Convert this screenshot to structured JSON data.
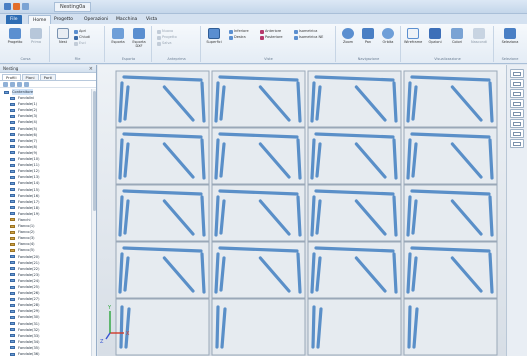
{
  "titlebar": {
    "doc_tab": "Nesting0a"
  },
  "tabs": [
    {
      "label": "File",
      "kind": "file"
    },
    {
      "label": "Home",
      "kind": "active"
    },
    {
      "label": "Progetto",
      "kind": "normal"
    },
    {
      "label": "Operazioni",
      "kind": "normal"
    },
    {
      "label": "Macchina",
      "kind": "normal"
    },
    {
      "label": "Vista",
      "kind": "normal"
    }
  ],
  "ribbon": {
    "groups": [
      {
        "name": "Corsa",
        "buttons": [
          "Progetto",
          "Prima"
        ]
      },
      {
        "name": "File",
        "buttons": [
          "Nest"
        ],
        "smalls": [
          "Apri",
          "Chiudi",
          "Esci"
        ]
      },
      {
        "name": "Esporta",
        "buttons": [
          "Esporta",
          "Esporta DXF"
        ]
      },
      {
        "name": "Anteprima",
        "smalls": [
          "Nuovo",
          "Progetto",
          "Salva"
        ]
      },
      {
        "name": "Viste",
        "buttons": [
          "Superfici"
        ],
        "smalls": [
          "Inferiore",
          "Destra",
          "Anteriore",
          "Posteriore",
          "Isometrica",
          "Isometrica NE"
        ]
      },
      {
        "name": "Navigazione",
        "buttons": [
          "Zoom",
          "Pan",
          "Orbita"
        ]
      },
      {
        "name": "Visualizzazione",
        "buttons": [
          "Wireframe",
          "Opzioni",
          "Colori",
          "Nascondi"
        ]
      },
      {
        "name": "Selezione",
        "buttons": [
          "Seleziona"
        ]
      }
    ]
  },
  "panel": {
    "title": "Nesting",
    "close": "×",
    "tabs": [
      "Profili",
      "Piani",
      "Parti"
    ],
    "tree": [
      {
        "label": "Contenitore",
        "indent": 0,
        "alt": false
      },
      {
        "label": "Fondalini",
        "indent": 1,
        "alt": false
      },
      {
        "label": "Fondale(1)",
        "indent": 1,
        "alt": false
      },
      {
        "label": "Fondale(2)",
        "indent": 1,
        "alt": false
      },
      {
        "label": "Fondale(3)",
        "indent": 1,
        "alt": false
      },
      {
        "label": "Fondale(4)",
        "indent": 1,
        "alt": false
      },
      {
        "label": "Fondale(5)",
        "indent": 1,
        "alt": false
      },
      {
        "label": "Fondale(6)",
        "indent": 1,
        "alt": false
      },
      {
        "label": "Fondale(7)",
        "indent": 1,
        "alt": false
      },
      {
        "label": "Fondale(8)",
        "indent": 1,
        "alt": false
      },
      {
        "label": "Fondale(9)",
        "indent": 1,
        "alt": false
      },
      {
        "label": "Fondale(10)",
        "indent": 1,
        "alt": false
      },
      {
        "label": "Fondale(11)",
        "indent": 1,
        "alt": false
      },
      {
        "label": "Fondale(12)",
        "indent": 1,
        "alt": false
      },
      {
        "label": "Fondale(13)",
        "indent": 1,
        "alt": false
      },
      {
        "label": "Fondale(14)",
        "indent": 1,
        "alt": false
      },
      {
        "label": "Fondale(15)",
        "indent": 1,
        "alt": false
      },
      {
        "label": "Fondale(16)",
        "indent": 1,
        "alt": false
      },
      {
        "label": "Fondale(17)",
        "indent": 1,
        "alt": false
      },
      {
        "label": "Fondale(18)",
        "indent": 1,
        "alt": false
      },
      {
        "label": "Fondale(19)",
        "indent": 1,
        "alt": false
      },
      {
        "label": "Fianchi",
        "indent": 1,
        "alt": true
      },
      {
        "label": "Fianco(1)",
        "indent": 1,
        "alt": true
      },
      {
        "label": "Fianco(2)",
        "indent": 1,
        "alt": true
      },
      {
        "label": "Fianco(3)",
        "indent": 1,
        "alt": true
      },
      {
        "label": "Fianco(4)",
        "indent": 1,
        "alt": true
      },
      {
        "label": "Fianco(5)",
        "indent": 1,
        "alt": true
      },
      {
        "label": "Fondale(20)",
        "indent": 1,
        "alt": false
      },
      {
        "label": "Fondale(21)",
        "indent": 1,
        "alt": false
      },
      {
        "label": "Fondale(22)",
        "indent": 1,
        "alt": false
      },
      {
        "label": "Fondale(23)",
        "indent": 1,
        "alt": false
      },
      {
        "label": "Fondale(24)",
        "indent": 1,
        "alt": false
      },
      {
        "label": "Fondale(25)",
        "indent": 1,
        "alt": false
      },
      {
        "label": "Fondale(26)",
        "indent": 1,
        "alt": false
      },
      {
        "label": "Fondale(27)",
        "indent": 1,
        "alt": false
      },
      {
        "label": "Fondale(28)",
        "indent": 1,
        "alt": false
      },
      {
        "label": "Fondale(29)",
        "indent": 1,
        "alt": false
      },
      {
        "label": "Fondale(30)",
        "indent": 1,
        "alt": false
      },
      {
        "label": "Fondale(31)",
        "indent": 1,
        "alt": false
      },
      {
        "label": "Fondale(32)",
        "indent": 1,
        "alt": false
      },
      {
        "label": "Fondale(33)",
        "indent": 1,
        "alt": false
      },
      {
        "label": "Fondale(34)",
        "indent": 1,
        "alt": false
      },
      {
        "label": "Fondale(35)",
        "indent": 1,
        "alt": false
      },
      {
        "label": "Fondale(36)",
        "indent": 1,
        "alt": false
      }
    ]
  },
  "viewport": {
    "grid_cols": 4,
    "grid_rows": 5,
    "axis_labels": {
      "x": "X",
      "y": "Y",
      "z": "Z"
    }
  },
  "colors": {
    "part": "#5a8fc8",
    "sheet_edge": "#9aa8b8",
    "axis_x": "#d23a2a",
    "axis_y": "#2aa53a",
    "axis_z": "#3a55d2"
  }
}
